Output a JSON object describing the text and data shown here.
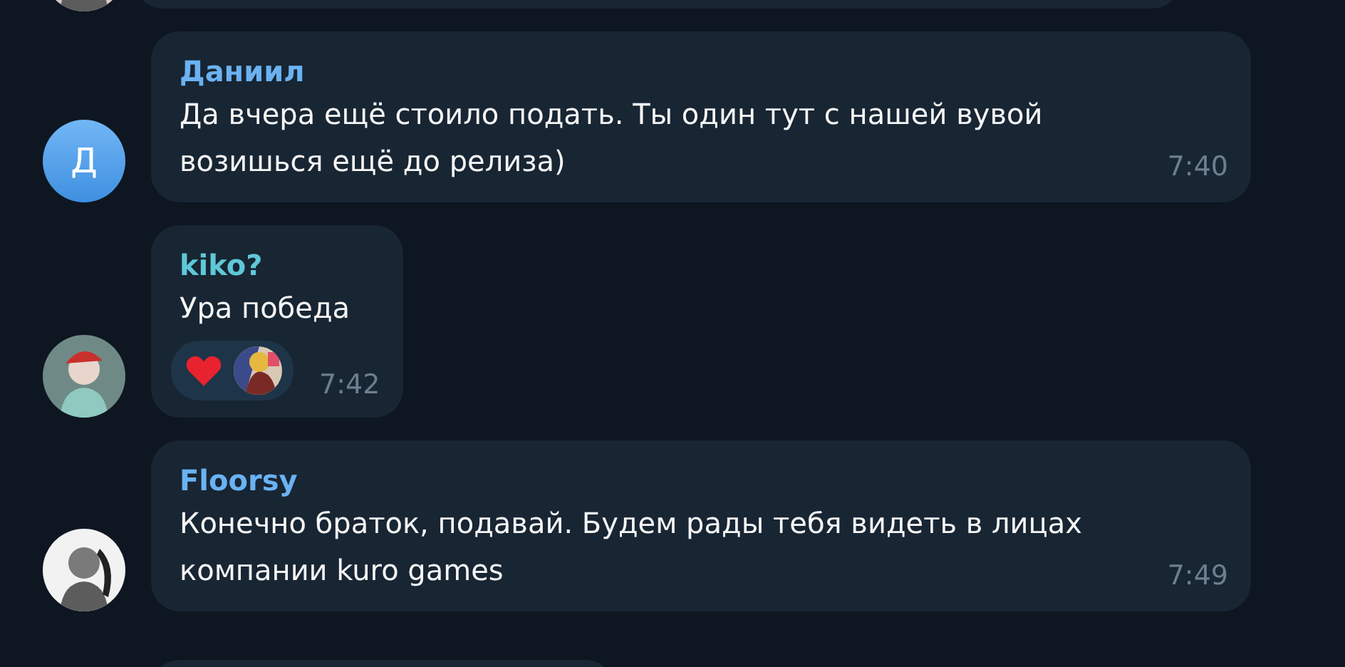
{
  "messages": [
    {
      "kind": "cut"
    },
    {
      "kind": "text",
      "author": "Даниил",
      "color": "#6ab2f2",
      "avatar": {
        "kind": "letter",
        "letter": "Д"
      },
      "text": "Да вчера ещё стоило подать. Ты один тут с нашей вувой возишься ещё до релиза)",
      "time": "7:40"
    },
    {
      "kind": "text",
      "author": "kiko?",
      "color": "#5fc8d8",
      "text": "Ура победа",
      "reactions": [
        {
          "kind": "heart"
        },
        {
          "kind": "avatar"
        }
      ],
      "time": "7:42"
    },
    {
      "kind": "text",
      "author": "Floorsy",
      "color": "#6ab2f2",
      "text": "Конечно браток, подавай. Будем рады тебя видеть в лицах компании kuro games",
      "time": "7:49"
    },
    {
      "kind": "cut"
    }
  ]
}
